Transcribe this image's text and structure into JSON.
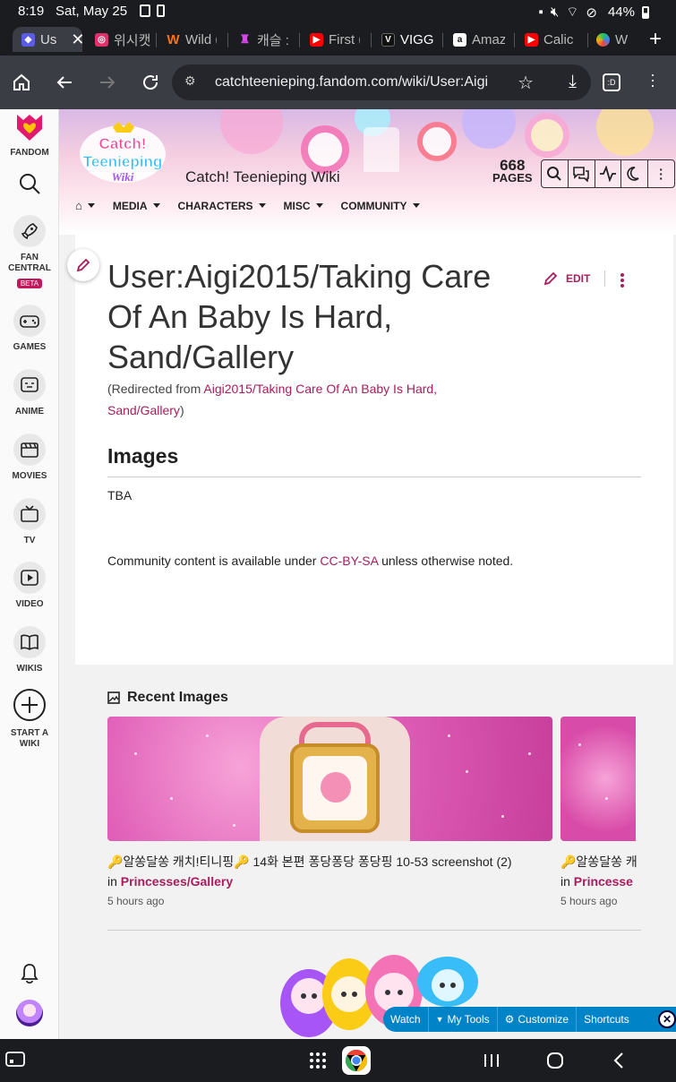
{
  "status_bar": {
    "time": "8:19",
    "date": "Sat, May 25",
    "battery": "44%"
  },
  "tabs": [
    {
      "label": "Us",
      "fav_color": "#5b5ce6",
      "active": true
    },
    {
      "label": "위시캣",
      "fav_color": "#e1306c"
    },
    {
      "label": "Wild (",
      "fav_color": "#f97316"
    },
    {
      "label": "캐슬 :",
      "fav_color": "#d946ef"
    },
    {
      "label": "First (",
      "fav_color": "#ff0000"
    },
    {
      "label": "VIGGI",
      "fav_color": "#111111"
    },
    {
      "label": "Amaz",
      "fav_color": "#ffffff"
    },
    {
      "label": "Calic",
      "fav_color": "#ff0000"
    },
    {
      "label": "W",
      "fav_color": "#22c55e"
    }
  ],
  "url": "catchteenieping.fandom.com/wiki/User:Aigi",
  "tab_switcher": ":D",
  "rail": {
    "fandom": "FANDOM",
    "fan_central": "FAN CENTRAL",
    "beta": "BETA",
    "games": "GAMES",
    "anime": "ANIME",
    "movies": "MOVIES",
    "tv": "TV",
    "video": "VIDEO",
    "wikis": "WIKIS",
    "start_wiki": "START A WIKI"
  },
  "wiki": {
    "name": "Catch! Teenieping Wiki",
    "logo_line1": "Catch!",
    "logo_line2": "Teenieping",
    "logo_line3": "Wiki",
    "pages_count": "668",
    "pages_label": "PAGES",
    "nav": [
      "MEDIA",
      "CHARACTERS",
      "MISC",
      "COMMUNITY"
    ]
  },
  "article": {
    "title": "User:Aigi2015/Taking Care Of An Baby Is Hard, Sand/Gallery",
    "edit_label": "EDIT",
    "redirect_prefix": "(Redirected from ",
    "redirect_link": "Aigi2015/Taking Care Of An Baby Is Hard, Sand/Gallery",
    "redirect_suffix": ")",
    "heading": "Images",
    "body": "TBA",
    "license_prefix": "Community content is available under ",
    "license_link": "CC-BY-SA",
    "license_suffix": " unless otherwise noted."
  },
  "recent_images": {
    "heading": "Recent Images",
    "items": [
      {
        "caption": "🔑알쏭달쏭 캐치!티니핑🔑 14화 본편 퐁당퐁당 퐁당핑 10-53 screenshot (2)",
        "in_prefix": "in ",
        "in_link": "Princesses/Gallery",
        "time": "5 hours ago"
      },
      {
        "caption": "🔑알쏭달쏭 캐치",
        "in_prefix": "in ",
        "in_link": "Princesse",
        "time": "5 hours ago"
      }
    ]
  },
  "toolbar": {
    "watch": "Watch",
    "my_tools": "My Tools",
    "customize": "Customize",
    "shortcuts": "Shortcuts"
  }
}
